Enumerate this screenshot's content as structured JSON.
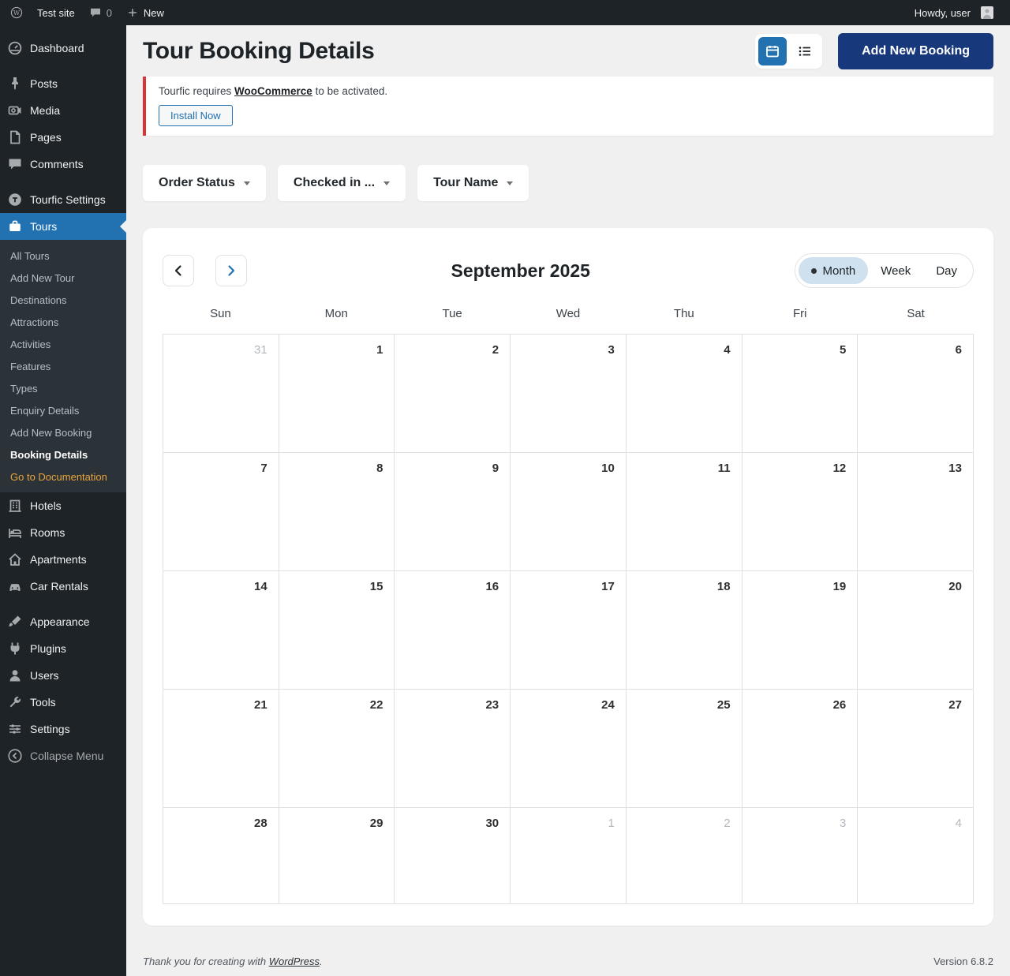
{
  "admin_bar": {
    "site_name": "Test site",
    "comments_count": "0",
    "new_label": "New",
    "howdy": "Howdy, user"
  },
  "sidebar": {
    "items": [
      {
        "label": "Dashboard",
        "icon": "dashboard",
        "gap_after": true
      },
      {
        "label": "Posts",
        "icon": "posts"
      },
      {
        "label": "Media",
        "icon": "media"
      },
      {
        "label": "Pages",
        "icon": "pages"
      },
      {
        "label": "Comments",
        "icon": "comments",
        "gap_after": true
      },
      {
        "label": "Tourfic Settings",
        "icon": "tourfic-settings"
      },
      {
        "label": "Tours",
        "icon": "tours",
        "active": true
      },
      {
        "label": "Hotels",
        "icon": "hotels"
      },
      {
        "label": "Rooms",
        "icon": "rooms"
      },
      {
        "label": "Apartments",
        "icon": "apartments"
      },
      {
        "label": "Car Rentals",
        "icon": "car-rentals",
        "gap_after": true
      },
      {
        "label": "Appearance",
        "icon": "appearance"
      },
      {
        "label": "Plugins",
        "icon": "plugins"
      },
      {
        "label": "Users",
        "icon": "users"
      },
      {
        "label": "Tools",
        "icon": "tools"
      },
      {
        "label": "Settings",
        "icon": "settings"
      }
    ],
    "tours_submenu": [
      {
        "label": "All Tours"
      },
      {
        "label": "Add New Tour"
      },
      {
        "label": "Destinations"
      },
      {
        "label": "Attractions"
      },
      {
        "label": "Activities"
      },
      {
        "label": "Features"
      },
      {
        "label": "Types"
      },
      {
        "label": "Enquiry Details"
      },
      {
        "label": "Add New Booking"
      },
      {
        "label": "Booking Details",
        "current": true
      },
      {
        "label": "Go to Documentation",
        "highlight": true
      }
    ],
    "collapse_label": "Collapse Menu"
  },
  "page": {
    "title": "Tour Booking Details",
    "add_booking_button": "Add New Booking"
  },
  "notice": {
    "message_before_link": "Tourfic requires ",
    "link_text": "WooCommerce",
    "message_after_link": " to be activated.",
    "install_button": "Install Now"
  },
  "filters": [
    {
      "label": "Order Status"
    },
    {
      "label": "Checked in ..."
    },
    {
      "label": "Tour Name"
    }
  ],
  "calendar": {
    "title": "September 2025",
    "views": [
      {
        "label": "Month",
        "active": true
      },
      {
        "label": "Week",
        "active": false
      },
      {
        "label": "Day",
        "active": false
      }
    ],
    "day_headers": [
      "Sun",
      "Mon",
      "Tue",
      "Wed",
      "Thu",
      "Fri",
      "Sat"
    ],
    "weeks": [
      [
        {
          "day": "31",
          "other_month": true
        },
        {
          "day": "1"
        },
        {
          "day": "2"
        },
        {
          "day": "3"
        },
        {
          "day": "4"
        },
        {
          "day": "5"
        },
        {
          "day": "6"
        }
      ],
      [
        {
          "day": "7"
        },
        {
          "day": "8"
        },
        {
          "day": "9"
        },
        {
          "day": "10"
        },
        {
          "day": "11"
        },
        {
          "day": "12"
        },
        {
          "day": "13"
        }
      ],
      [
        {
          "day": "14"
        },
        {
          "day": "15"
        },
        {
          "day": "16"
        },
        {
          "day": "17"
        },
        {
          "day": "18"
        },
        {
          "day": "19"
        },
        {
          "day": "20"
        }
      ],
      [
        {
          "day": "21"
        },
        {
          "day": "22"
        },
        {
          "day": "23"
        },
        {
          "day": "24"
        },
        {
          "day": "25"
        },
        {
          "day": "26"
        },
        {
          "day": "27"
        }
      ],
      [
        {
          "day": "28"
        },
        {
          "day": "29"
        },
        {
          "day": "30"
        },
        {
          "day": "1",
          "other_month": true
        },
        {
          "day": "2",
          "other_month": true
        },
        {
          "day": "3",
          "other_month": true
        },
        {
          "day": "4",
          "other_month": true
        }
      ]
    ]
  },
  "footer": {
    "thanks_before_link": "Thank you for creating with ",
    "link_text": "WordPress",
    "thanks_after_link": ".",
    "version": "Version 6.8.2"
  },
  "colors": {
    "accent": "#2271b1",
    "primary_button": "#17397c",
    "notice_border": "#d63638",
    "active_view_pill": "#cfe0ef",
    "doc_link": "#e8a33d"
  }
}
